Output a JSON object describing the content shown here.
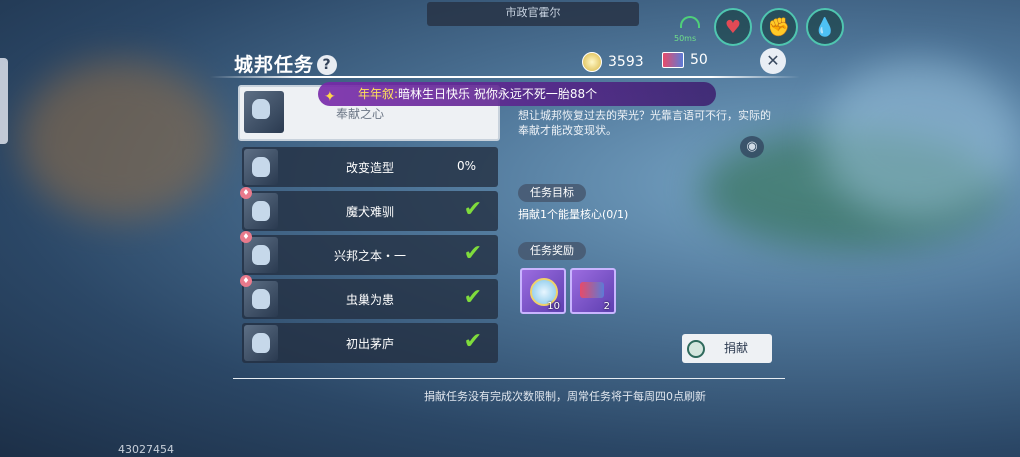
{
  "npc_name": "市政官霍尔",
  "signal_text": "50ms",
  "panel": {
    "title": "城邦任务",
    "help": "?",
    "currency": [
      {
        "icon": "coin-icon",
        "value": "3593"
      },
      {
        "icon": "ticket-icon",
        "value": "50"
      }
    ],
    "close": "✕"
  },
  "marquee": {
    "speaker": "年年叙:",
    "message": "暗林生日快乐 祝你永远不死一胎88个"
  },
  "selected_task": {
    "label": "奉献之心"
  },
  "tasks": [
    {
      "name": "改变造型",
      "progress": "0%",
      "done": false
    },
    {
      "name": "魔犬难驯",
      "done": true
    },
    {
      "name": "兴邦之本・一",
      "done": true
    },
    {
      "name": "虫巢为患",
      "done": true
    },
    {
      "name": "初出茅庐",
      "done": true
    }
  ],
  "detail": {
    "description": "想让城邦恢复过去的荣光？光靠言语可不行，实际的奉献才能改变现状。",
    "goal_header": "任务目标",
    "goal_text": "捐献1个能量核心(0/1)",
    "reward_header": "任务奖励",
    "rewards": [
      {
        "icon": "medal-icon",
        "count": "10"
      },
      {
        "icon": "ticket-icon",
        "count": "2"
      }
    ],
    "donate_button": "捐献"
  },
  "footer_note": "捐献任务没有完成次数限制，周常任务将于每周四0点刷新",
  "uid": "43027454"
}
